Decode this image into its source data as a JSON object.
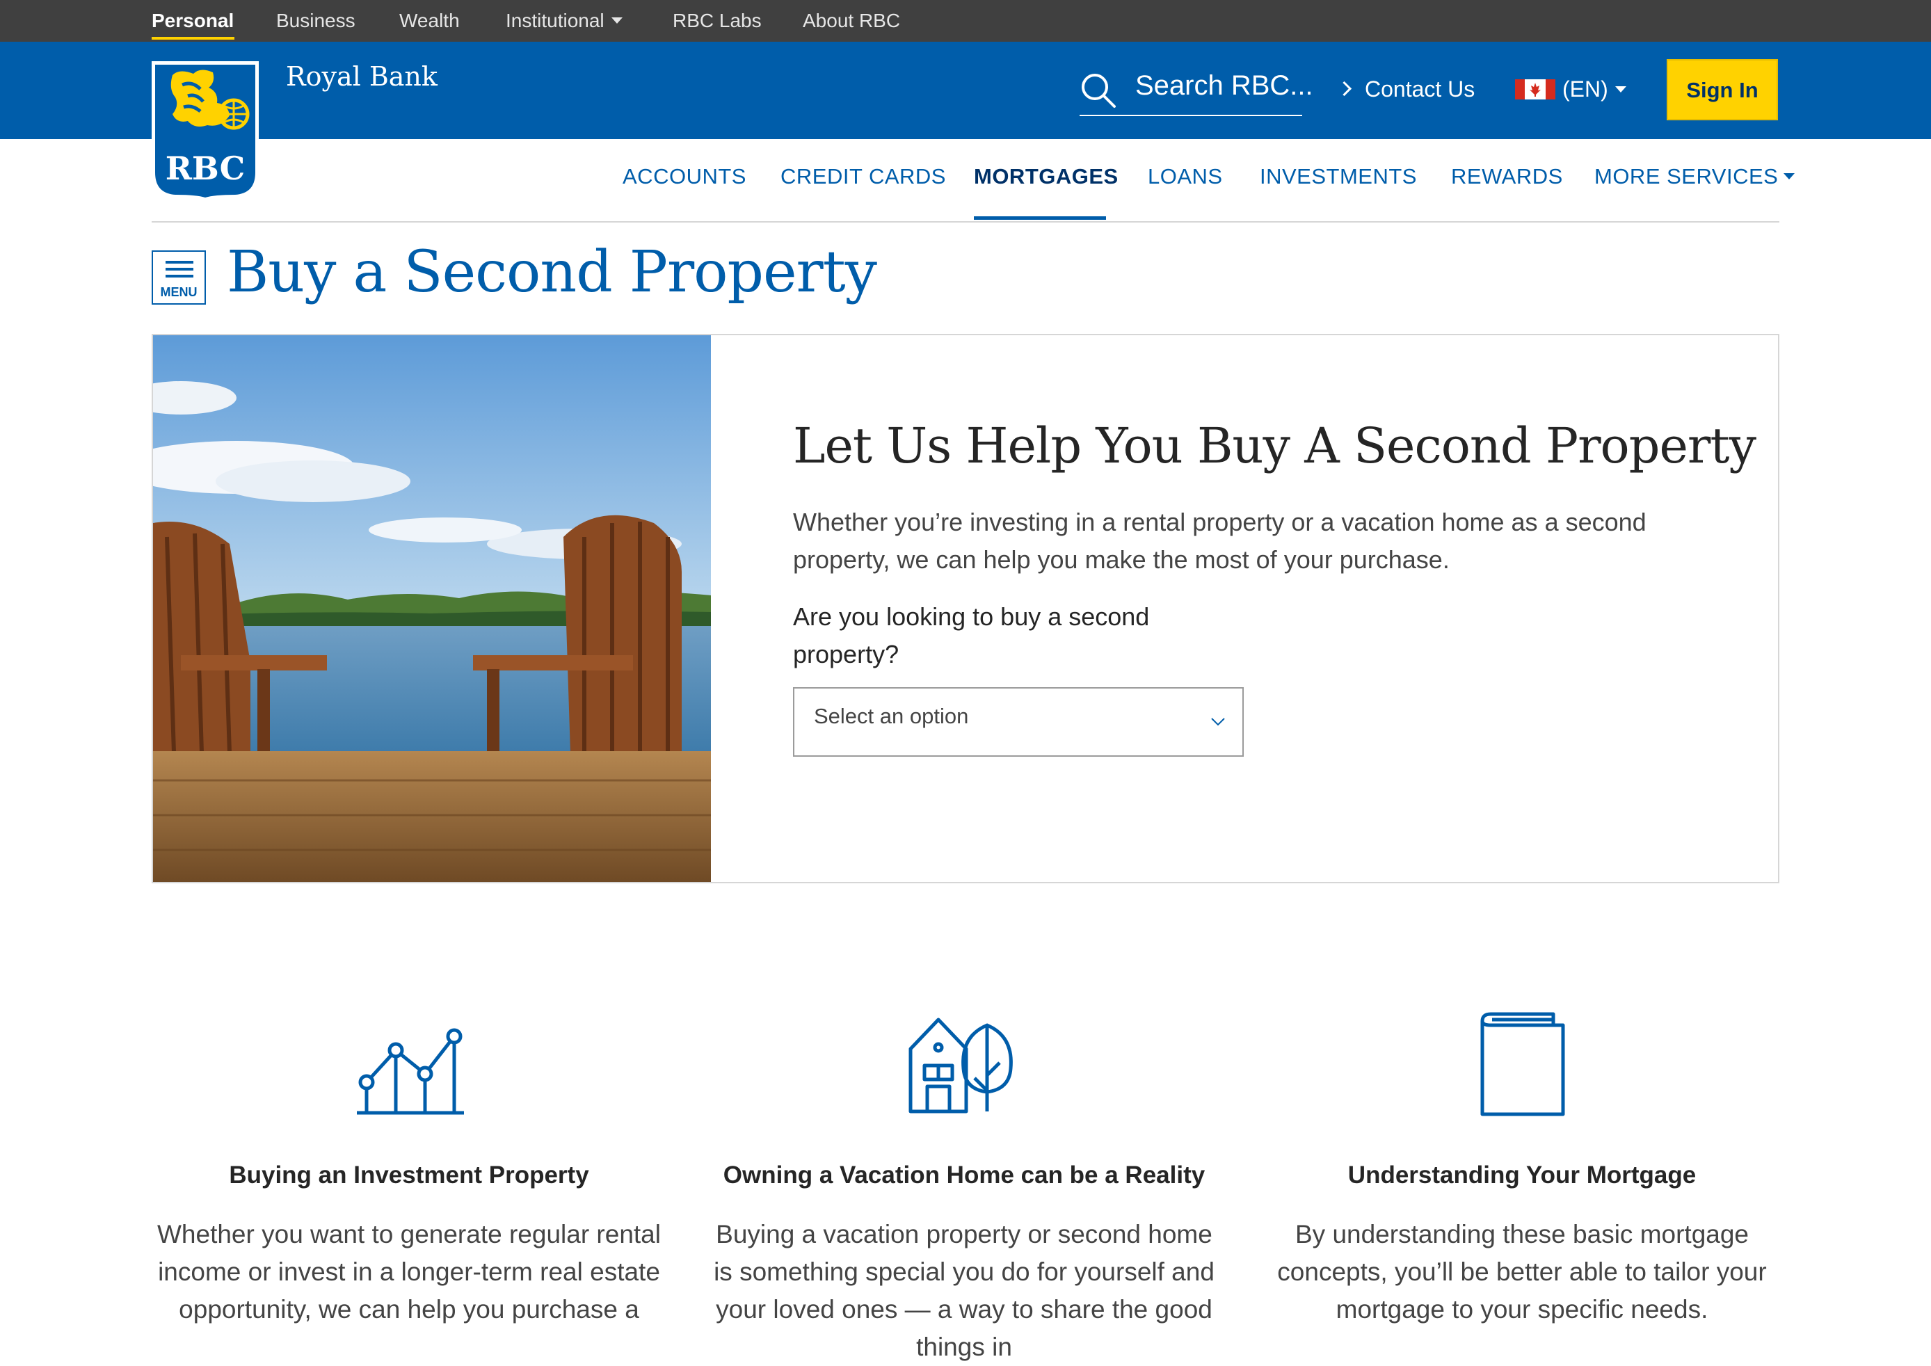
{
  "util_nav": {
    "items": [
      {
        "label": "Personal",
        "active": true
      },
      {
        "label": "Business"
      },
      {
        "label": "Wealth"
      },
      {
        "label": "Institutional",
        "dropdown": true
      },
      {
        "label": "RBC Labs"
      },
      {
        "label": "About RBC"
      }
    ]
  },
  "header": {
    "brand": "Royal Bank",
    "logo_text": "RBC",
    "search_placeholder": "Search RBC...",
    "contact_label": "Contact Us",
    "lang_label": "(EN)",
    "signin_label": "Sign In"
  },
  "main_nav": {
    "items": [
      {
        "label": "ACCOUNTS"
      },
      {
        "label": "CREDIT CARDS"
      },
      {
        "label": "MORTGAGES",
        "active": true
      },
      {
        "label": "LOANS"
      },
      {
        "label": "INVESTMENTS"
      },
      {
        "label": "REWARDS"
      },
      {
        "label": "MORE SERVICES",
        "dropdown": true
      }
    ]
  },
  "page": {
    "menu_label": "MENU",
    "title": "Buy a Second Property"
  },
  "hero": {
    "heading": "Let Us Help You Buy A Second Property",
    "paragraph": "Whether you’re investing in a rental property or a vacation home as a second property, we can help you make the most of your purchase.",
    "question": "Are you looking to buy a second property?",
    "select_placeholder": "Select an option"
  },
  "features": [
    {
      "icon": "line-chart-icon",
      "title": "Buying an Investment Property",
      "text": "Whether you want to generate regular rental income or invest in a longer-term real estate opportunity, we can help you purchase a"
    },
    {
      "icon": "house-tree-icon",
      "title": "Owning a Vacation Home can be a Reality",
      "text": "Buying a vacation property or second home is something special you do for yourself and your loved ones — a way to share the good things in"
    },
    {
      "icon": "book-icon",
      "title": "Understanding Your Mortgage",
      "text": "By understanding these basic mortgage concepts, you’ll be better able to tailor your mortgage to your specific needs."
    }
  ],
  "colors": {
    "brand_blue": "#005daa",
    "dark_blue": "#003168",
    "accent_yellow": "#ffd200",
    "util_bar": "#404040"
  }
}
